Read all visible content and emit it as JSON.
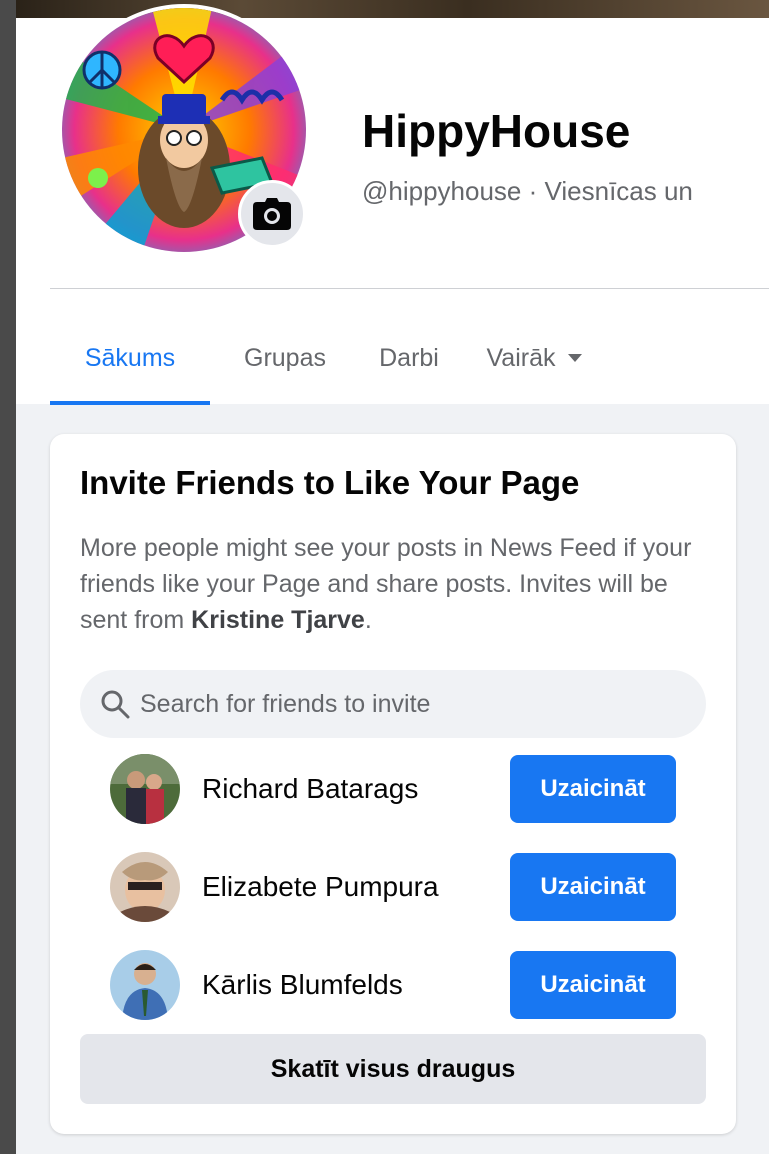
{
  "page": {
    "name": "HippyHouse",
    "handle": "@hippyhouse · Viesnīcas un"
  },
  "tabs": [
    {
      "label": "Sākums",
      "active": true
    },
    {
      "label": "Grupas",
      "active": false
    },
    {
      "label": "Darbi",
      "active": false
    },
    {
      "label": "Vairāk",
      "active": false
    }
  ],
  "invite_card": {
    "title": "Invite Friends to Like Your Page",
    "desc_pre": "More people might see your posts in News Feed if your friends like your Page and share posts. Invites will be sent from ",
    "desc_name": "Kristine Tjarve",
    "desc_post": ".",
    "search_placeholder": "Search for friends to invite",
    "friends": [
      {
        "name": "Richard Batarags",
        "button": "Uzaicināt"
      },
      {
        "name": "Elizabete Pumpura",
        "button": "Uzaicināt"
      },
      {
        "name": "Kārlis Blumfelds",
        "button": "Uzaicināt"
      }
    ],
    "see_all": "Skatīt visus draugus"
  },
  "colors": {
    "accent": "#1877f2",
    "secondary_button": "#e4e6eb",
    "background": "#f0f2f5"
  },
  "icons": {
    "camera": "camera-icon",
    "search": "search-icon",
    "dropdown": "caret-down-icon"
  }
}
